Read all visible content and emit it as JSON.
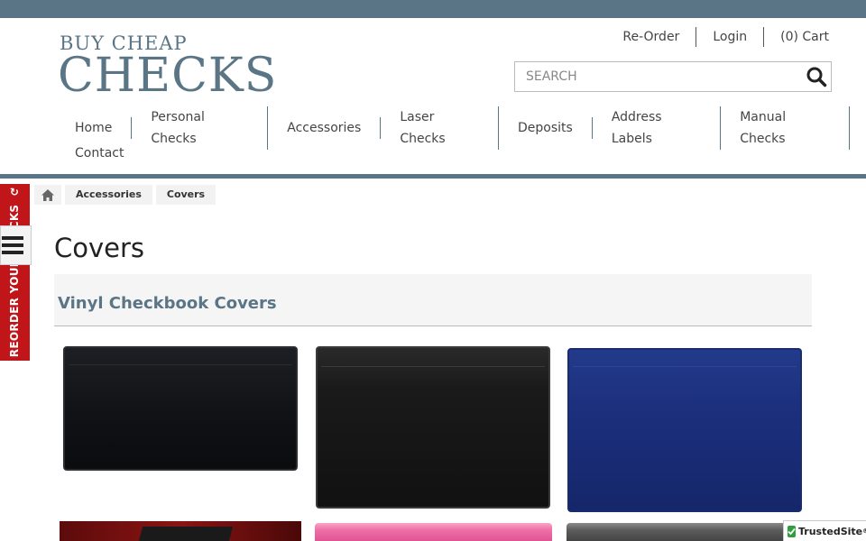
{
  "header": {
    "logo_top": "BUY CHEAP",
    "logo_main": "CHECKS",
    "util_links": [
      {
        "label": "Re-Order"
      },
      {
        "label": "Login"
      },
      {
        "label": "(0) Cart"
      }
    ],
    "search_placeholder": "SEARCH"
  },
  "nav": {
    "items": [
      {
        "label": "Home"
      },
      {
        "label": "Personal Checks"
      },
      {
        "label": "Accessories"
      },
      {
        "label": "Laser Checks"
      },
      {
        "label": "Deposits"
      },
      {
        "label": "Address Labels"
      },
      {
        "label": "Manual Checks"
      },
      {
        "label": "Contact"
      }
    ]
  },
  "reorder_tab": {
    "label": "REORDER YOUR CHECKS"
  },
  "breadcrumb": {
    "items": [
      "Accessories",
      "Covers"
    ]
  },
  "page": {
    "title": "Covers",
    "category_title": "Vinyl Checkbook Covers"
  },
  "products": [
    {
      "color": "#111318",
      "name": "black-cover"
    },
    {
      "color": "#161616",
      "name": "black-cover-2"
    },
    {
      "color": "#1b2f7c",
      "name": "blue-cover"
    },
    {
      "color": "#7a1010",
      "name": "red-cover"
    },
    {
      "color": "#ee6fa5",
      "name": "pink-cover"
    },
    {
      "color": "#5c5c5c",
      "name": "gray-cover"
    }
  ],
  "trusted_badge": {
    "label": "TrustedSite",
    "mark": "®"
  },
  "colors": {
    "brand": "#5a7585",
    "reorder_red": "#c0161a"
  }
}
